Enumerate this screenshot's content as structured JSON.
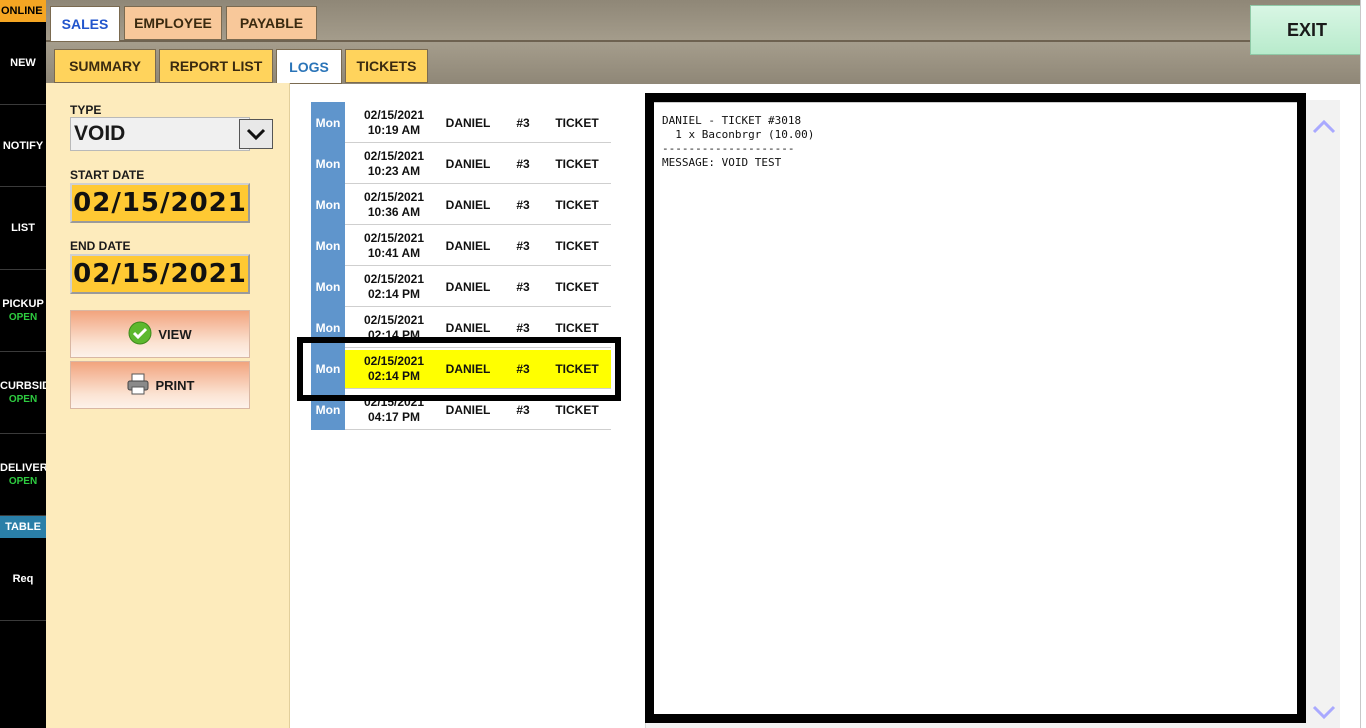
{
  "rail": {
    "status": "ONLINE",
    "items": [
      {
        "label": "NEW",
        "sub": ""
      },
      {
        "label": "NOTIFY",
        "sub": ""
      },
      {
        "label": "LIST",
        "sub": ""
      },
      {
        "label": "PICKUP",
        "sub": "OPEN"
      },
      {
        "label": "CURBSIDE",
        "sub": "OPEN"
      },
      {
        "label": "DELIVERY",
        "sub": "OPEN"
      }
    ],
    "table_tag": "TABLE",
    "req": "Req"
  },
  "top_tabs": [
    "SALES",
    "EMPLOYEE",
    "PAYABLE"
  ],
  "sub_tabs": [
    "SUMMARY",
    "REPORT LIST",
    "LOGS",
    "TICKETS"
  ],
  "exit_label": "EXIT",
  "filters": {
    "type_label": "TYPE",
    "type_value": "VOID",
    "start_label": "START DATE",
    "start_value": "02/15/2021",
    "end_label": "END DATE",
    "end_value": "02/15/2021",
    "view_label": "VIEW",
    "print_label": "PRINT"
  },
  "logs": [
    {
      "day": "Mon",
      "date": "02/15/2021",
      "time": "10:19 AM",
      "employee": "DANIEL",
      "terminal": "#3",
      "kind": "TICKET"
    },
    {
      "day": "Mon",
      "date": "02/15/2021",
      "time": "10:23 AM",
      "employee": "DANIEL",
      "terminal": "#3",
      "kind": "TICKET"
    },
    {
      "day": "Mon",
      "date": "02/15/2021",
      "time": "10:36 AM",
      "employee": "DANIEL",
      "terminal": "#3",
      "kind": "TICKET"
    },
    {
      "day": "Mon",
      "date": "02/15/2021",
      "time": "10:41 AM",
      "employee": "DANIEL",
      "terminal": "#3",
      "kind": "TICKET"
    },
    {
      "day": "Mon",
      "date": "02/15/2021",
      "time": "02:14 PM",
      "employee": "DANIEL",
      "terminal": "#3",
      "kind": "TICKET"
    },
    {
      "day": "Mon",
      "date": "02/15/2021",
      "time": "02:14 PM",
      "employee": "DANIEL",
      "terminal": "#3",
      "kind": "TICKET"
    },
    {
      "day": "Mon",
      "date": "02/15/2021",
      "time": "02:14 PM",
      "employee": "DANIEL",
      "terminal": "#3",
      "kind": "TICKET"
    },
    {
      "day": "Mon",
      "date": "02/15/2021",
      "time": "04:17 PM",
      "employee": "DANIEL",
      "terminal": "#3",
      "kind": "TICKET"
    }
  ],
  "selected_index": 6,
  "detail": {
    "line1": "DANIEL - TICKET #3018",
    "line2": "  1 x Baconbrgr (10.00)",
    "line3": "--------------------",
    "line4": "MESSAGE: VOID TEST"
  },
  "colors": {
    "accent_blue": "#5f95cc",
    "highlight": "#ffff00",
    "date_yellow": "#ffc933"
  }
}
